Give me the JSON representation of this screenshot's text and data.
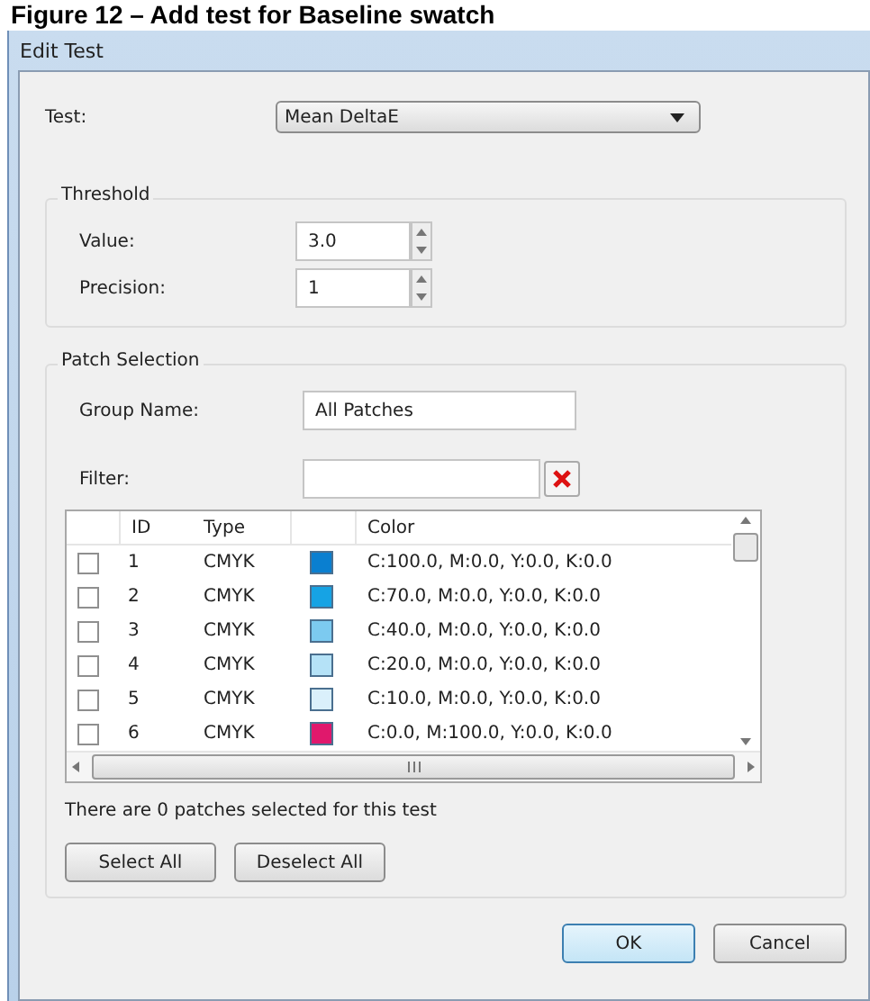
{
  "caption": "Figure 12 – Add test for Baseline swatch",
  "window": {
    "title": "Edit Test"
  },
  "test": {
    "label": "Test:",
    "value": "Mean DeltaE"
  },
  "threshold": {
    "title": "Threshold",
    "fields": [
      {
        "label": "Value:",
        "value": "3.0"
      },
      {
        "label": "Precision:",
        "value": "1"
      }
    ]
  },
  "patch_selection": {
    "title": "Patch Selection",
    "group_name": {
      "label": "Group Name:",
      "value": "All Patches"
    },
    "filter": {
      "label": "Filter:"
    },
    "table": {
      "columns": [
        "ID",
        "Type",
        "Color"
      ],
      "rows": [
        {
          "checked": false,
          "id": "1",
          "type": "CMYK",
          "color": "#0a7fd0",
          "value": "C:100.0, M:0.0, Y:0.0, K:0.0"
        },
        {
          "checked": false,
          "id": "2",
          "type": "CMYK",
          "color": "#16a3e4",
          "value": "C:70.0, M:0.0, Y:0.0, K:0.0"
        },
        {
          "checked": false,
          "id": "3",
          "type": "CMYK",
          "color": "#7ccaf0",
          "value": "C:40.0, M:0.0, Y:0.0, K:0.0"
        },
        {
          "checked": false,
          "id": "4",
          "type": "CMYK",
          "color": "#b5e2f7",
          "value": "C:20.0, M:0.0, Y:0.0, K:0.0"
        },
        {
          "checked": false,
          "id": "5",
          "type": "CMYK",
          "color": "#daf0fb",
          "value": "C:10.0, M:0.0, Y:0.0, K:0.0"
        },
        {
          "checked": false,
          "id": "6",
          "type": "CMYK",
          "color": "#e0186c",
          "value": "C:0.0, M:100.0, Y:0.0, K:0.0"
        }
      ]
    },
    "status": "There are 0 patches selected for this test",
    "buttons": [
      "Select All",
      "Deselect All"
    ]
  },
  "buttons": [
    {
      "label": "OK",
      "default": true
    },
    {
      "label": "Cancel",
      "default": false
    }
  ]
}
